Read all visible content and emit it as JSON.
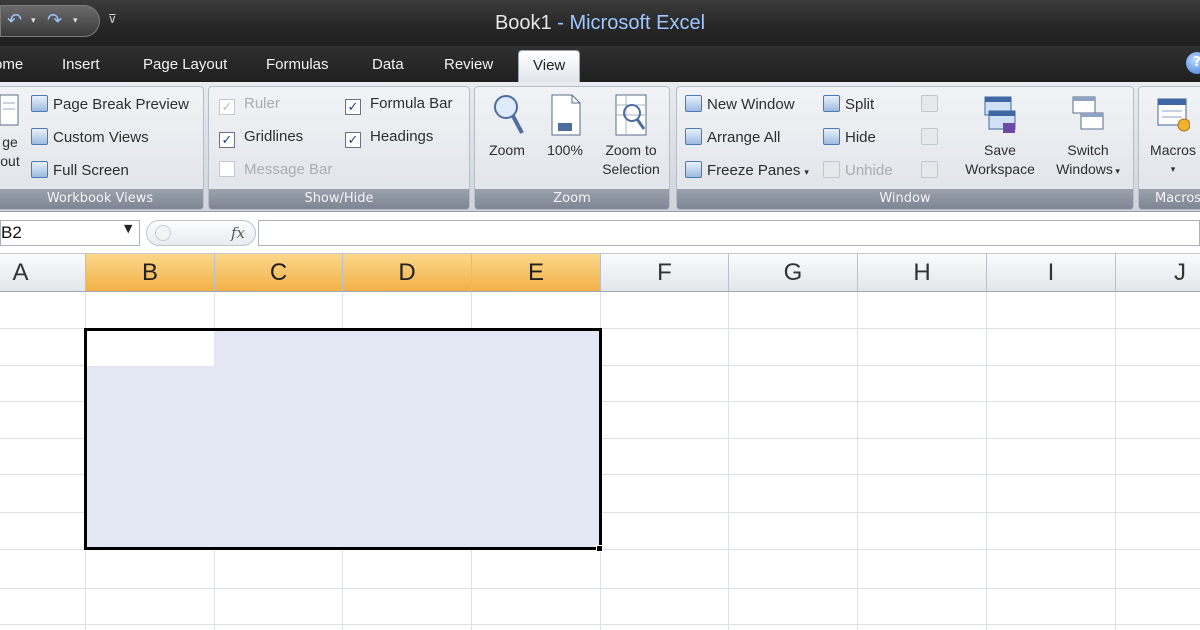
{
  "window": {
    "doc_name": "Book1",
    "separator": " - ",
    "app_name": "Microsoft Excel"
  },
  "tabs": [
    {
      "label": "ome",
      "active": false
    },
    {
      "label": "Insert",
      "active": false
    },
    {
      "label": "Page Layout",
      "active": false
    },
    {
      "label": "Formulas",
      "active": false
    },
    {
      "label": "Data",
      "active": false
    },
    {
      "label": "Review",
      "active": false
    },
    {
      "label": "View",
      "active": true
    }
  ],
  "ribbon": {
    "workbook_views": {
      "label": "Workbook Views",
      "page_layout_line1": "ge",
      "page_layout_line2": "out",
      "page_break_preview": "Page Break Preview",
      "custom_views": "Custom Views",
      "full_screen": "Full Screen"
    },
    "show_hide": {
      "label": "Show/Hide",
      "ruler": {
        "text": "Ruler",
        "checked": true,
        "enabled": false
      },
      "gridlines": {
        "text": "Gridlines",
        "checked": true,
        "enabled": true
      },
      "message_bar": {
        "text": "Message Bar",
        "checked": false,
        "enabled": false
      },
      "formula_bar": {
        "text": "Formula Bar",
        "checked": true,
        "enabled": true
      },
      "headings": {
        "text": "Headings",
        "checked": true,
        "enabled": true
      }
    },
    "zoom": {
      "label": "Zoom",
      "zoom": "Zoom",
      "hundred": "100%",
      "zoom_to_selection_line1": "Zoom to",
      "zoom_to_selection_line2": "Selection"
    },
    "window": {
      "label": "Window",
      "new_window": "New Window",
      "arrange_all": "Arrange All",
      "freeze_panes": "Freeze Panes",
      "split": "Split",
      "hide": "Hide",
      "unhide": "Unhide",
      "save_workspace_line1": "Save",
      "save_workspace_line2": "Workspace",
      "switch_windows_line1": "Switch",
      "switch_windows_line2": "Windows"
    },
    "macros": {
      "label": "Macros",
      "button": "Macros"
    }
  },
  "formula_bar": {
    "name_box": "B2",
    "fx": "fx",
    "formula": ""
  },
  "columns": [
    "A",
    "B",
    "C",
    "D",
    "E",
    "F",
    "G",
    "H",
    "I",
    "J"
  ],
  "selected_columns": [
    "B",
    "C",
    "D",
    "E"
  ],
  "selection": {
    "active_cell": "B2",
    "range": "B2:E7"
  },
  "colors": {
    "selection_fill": "#e3e7f4",
    "selected_header": "#f3b048",
    "title_app": "#9fc6ff"
  }
}
